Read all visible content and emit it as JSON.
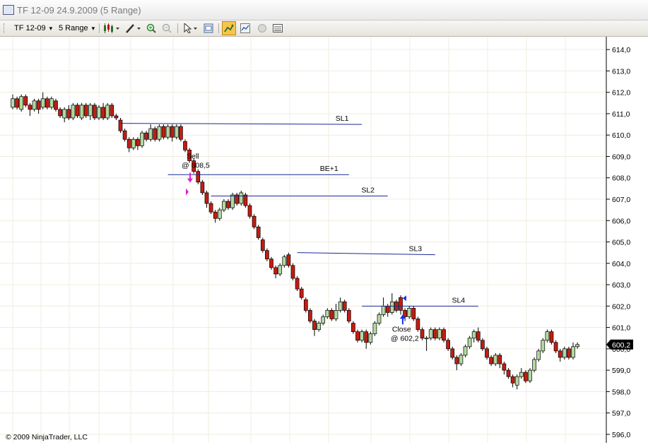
{
  "window": {
    "title": "TF 12-09   24.9.2009 (5 Range)"
  },
  "toolbar": {
    "instrument": "TF 12-09",
    "period": "5 Range",
    "icons": [
      "candlestick-icon",
      "pencil-icon",
      "zoom-in-icon",
      "zoom-out-icon",
      "cursor-icon",
      "properties-icon",
      "strategy-icon",
      "indicator-icon",
      "circle-icon",
      "data-box-icon"
    ]
  },
  "colors": {
    "up_candle": "#b4d9a2",
    "down_candle": "#c41c12",
    "draw_line": "#1c2896",
    "grid": "#f0ece0",
    "axis_bg": "#ffffff",
    "sell_marker": "#e020d0",
    "buy_marker": "#1030ff"
  },
  "chart_data": {
    "type": "candlestick",
    "ylim": [
      595.6,
      614.6
    ],
    "y_ticks": [
      "614,0",
      "613,0",
      "612,0",
      "611,0",
      "610,0",
      "609,0",
      "608,0",
      "607,0",
      "606,0",
      "605,0",
      "604,0",
      "603,0",
      "602,0",
      "601,0",
      "600,0",
      "599,0",
      "598,0",
      "597,0",
      "596,0"
    ],
    "candles": [
      {
        "o": 611.3,
        "c": 611.7,
        "h": 611.9,
        "l": 611.2
      },
      {
        "o": 611.7,
        "c": 611.3,
        "h": 611.8,
        "l": 611.2
      },
      {
        "o": 611.2,
        "c": 611.8,
        "h": 611.9,
        "l": 611.1
      },
      {
        "o": 611.8,
        "c": 611.4,
        "h": 611.9,
        "l": 611.3
      },
      {
        "o": 611.4,
        "c": 611.2,
        "h": 611.5,
        "l": 610.9
      },
      {
        "o": 611.2,
        "c": 611.6,
        "h": 611.7,
        "l": 611.1
      },
      {
        "o": 611.6,
        "c": 611.2,
        "h": 611.7,
        "l": 611.0
      },
      {
        "o": 611.3,
        "c": 611.7,
        "h": 612.0,
        "l": 611.2
      },
      {
        "o": 611.7,
        "c": 611.3,
        "h": 611.8,
        "l": 611.2
      },
      {
        "o": 611.3,
        "c": 611.7,
        "h": 611.8,
        "l": 611.2
      },
      {
        "o": 611.6,
        "c": 611.2,
        "h": 611.7,
        "l": 611.1
      },
      {
        "o": 611.2,
        "c": 610.9,
        "h": 611.3,
        "l": 610.8
      },
      {
        "o": 610.8,
        "c": 611.2,
        "h": 611.3,
        "l": 610.6
      },
      {
        "o": 611.2,
        "c": 610.8,
        "h": 611.4,
        "l": 610.7
      },
      {
        "o": 610.8,
        "c": 611.4,
        "h": 611.5,
        "l": 610.7
      },
      {
        "o": 611.4,
        "c": 610.9,
        "h": 611.5,
        "l": 610.8
      },
      {
        "o": 610.8,
        "c": 611.4,
        "h": 611.5,
        "l": 610.7
      },
      {
        "o": 611.4,
        "c": 610.9,
        "h": 611.5,
        "l": 610.8
      },
      {
        "o": 610.9,
        "c": 611.4,
        "h": 611.5,
        "l": 610.7
      },
      {
        "o": 611.4,
        "c": 610.8,
        "h": 611.5,
        "l": 610.7
      },
      {
        "o": 610.8,
        "c": 611.3,
        "h": 611.4,
        "l": 610.7
      },
      {
        "o": 611.3,
        "c": 610.8,
        "h": 611.5,
        "l": 610.7
      },
      {
        "o": 610.8,
        "c": 611.4,
        "h": 611.5,
        "l": 610.7
      },
      {
        "o": 611.4,
        "c": 610.9,
        "h": 611.5,
        "l": 610.8
      },
      {
        "o": 610.9,
        "c": 610.8,
        "h": 611.0,
        "l": 610.7
      },
      {
        "o": 610.7,
        "c": 610.2,
        "h": 610.8,
        "l": 610.1
      },
      {
        "o": 610.2,
        "c": 609.8,
        "h": 610.3,
        "l": 609.7
      },
      {
        "o": 609.8,
        "c": 609.4,
        "h": 609.9,
        "l": 609.2
      },
      {
        "o": 609.4,
        "c": 609.8,
        "h": 609.9,
        "l": 609.3
      },
      {
        "o": 609.8,
        "c": 609.5,
        "h": 609.9,
        "l": 609.3
      },
      {
        "o": 609.5,
        "c": 610.1,
        "h": 610.2,
        "l": 609.4
      },
      {
        "o": 610.1,
        "c": 609.8,
        "h": 610.2,
        "l": 609.7
      },
      {
        "o": 609.8,
        "c": 610.3,
        "h": 610.5,
        "l": 609.7
      },
      {
        "o": 610.3,
        "c": 609.8,
        "h": 610.4,
        "l": 609.7
      },
      {
        "o": 609.8,
        "c": 610.4,
        "h": 610.5,
        "l": 609.7
      },
      {
        "o": 610.4,
        "c": 609.9,
        "h": 610.5,
        "l": 609.8
      },
      {
        "o": 609.9,
        "c": 610.4,
        "h": 610.5,
        "l": 609.8
      },
      {
        "o": 610.4,
        "c": 609.9,
        "h": 610.5,
        "l": 609.7
      },
      {
        "o": 609.9,
        "c": 610.4,
        "h": 610.5,
        "l": 609.8
      },
      {
        "o": 610.4,
        "c": 609.8,
        "h": 610.5,
        "l": 609.7
      },
      {
        "o": 609.7,
        "c": 609.3,
        "h": 609.8,
        "l": 609.2
      },
      {
        "o": 609.3,
        "c": 608.8,
        "h": 609.4,
        "l": 608.7
      },
      {
        "o": 608.8,
        "c": 608.3,
        "h": 608.9,
        "l": 608.2
      },
      {
        "o": 608.3,
        "c": 607.8,
        "h": 608.4,
        "l": 607.7
      },
      {
        "o": 607.8,
        "c": 607.3,
        "h": 607.9,
        "l": 607.2
      },
      {
        "o": 607.3,
        "c": 606.8,
        "h": 607.4,
        "l": 606.6
      },
      {
        "o": 606.8,
        "c": 606.4,
        "h": 606.9,
        "l": 606.3
      },
      {
        "o": 606.4,
        "c": 606.1,
        "h": 606.5,
        "l": 605.9
      },
      {
        "o": 606.1,
        "c": 606.5,
        "h": 606.6,
        "l": 606.0
      },
      {
        "o": 606.5,
        "c": 606.9,
        "h": 607.0,
        "l": 606.4
      },
      {
        "o": 606.9,
        "c": 606.6,
        "h": 607.0,
        "l": 606.5
      },
      {
        "o": 606.6,
        "c": 607.2,
        "h": 607.3,
        "l": 606.5
      },
      {
        "o": 607.2,
        "c": 606.8,
        "h": 607.3,
        "l": 606.7
      },
      {
        "o": 606.8,
        "c": 607.3,
        "h": 607.4,
        "l": 606.7
      },
      {
        "o": 607.2,
        "c": 606.7,
        "h": 607.3,
        "l": 606.6
      },
      {
        "o": 606.7,
        "c": 606.2,
        "h": 606.8,
        "l": 606.1
      },
      {
        "o": 606.2,
        "c": 605.7,
        "h": 606.3,
        "l": 605.6
      },
      {
        "o": 605.7,
        "c": 605.2,
        "h": 605.8,
        "l": 605.1
      },
      {
        "o": 605.1,
        "c": 604.6,
        "h": 605.2,
        "l": 604.5
      },
      {
        "o": 604.6,
        "c": 604.2,
        "h": 604.7,
        "l": 604.1
      },
      {
        "o": 604.2,
        "c": 603.8,
        "h": 604.3,
        "l": 603.7
      },
      {
        "o": 603.8,
        "c": 603.5,
        "h": 603.9,
        "l": 603.3
      },
      {
        "o": 603.5,
        "c": 603.9,
        "h": 604.0,
        "l": 603.4
      },
      {
        "o": 603.9,
        "c": 604.3,
        "h": 604.4,
        "l": 603.8
      },
      {
        "o": 604.4,
        "c": 603.9,
        "h": 604.5,
        "l": 603.8
      },
      {
        "o": 603.9,
        "c": 603.3,
        "h": 604.0,
        "l": 603.2
      },
      {
        "o": 603.3,
        "c": 602.8,
        "h": 603.4,
        "l": 602.7
      },
      {
        "o": 602.8,
        "c": 602.4,
        "h": 602.9,
        "l": 602.3
      },
      {
        "o": 602.3,
        "c": 601.8,
        "h": 602.4,
        "l": 601.7
      },
      {
        "o": 601.8,
        "c": 601.3,
        "h": 601.9,
        "l": 601.2
      },
      {
        "o": 601.3,
        "c": 600.9,
        "h": 601.4,
        "l": 600.6
      },
      {
        "o": 600.9,
        "c": 601.2,
        "h": 601.3,
        "l": 600.8
      },
      {
        "o": 601.2,
        "c": 601.5,
        "h": 601.6,
        "l": 601.1
      },
      {
        "o": 601.5,
        "c": 601.8,
        "h": 601.9,
        "l": 601.4
      },
      {
        "o": 601.8,
        "c": 601.4,
        "h": 601.9,
        "l": 601.3
      },
      {
        "o": 601.4,
        "c": 601.8,
        "h": 602.1,
        "l": 601.3
      },
      {
        "o": 601.8,
        "c": 602.2,
        "h": 602.4,
        "l": 601.7
      },
      {
        "o": 602.2,
        "c": 601.8,
        "h": 602.3,
        "l": 601.7
      },
      {
        "o": 601.8,
        "c": 601.3,
        "h": 601.9,
        "l": 601.2
      },
      {
        "o": 601.2,
        "c": 600.8,
        "h": 601.3,
        "l": 600.7
      },
      {
        "o": 600.8,
        "c": 600.4,
        "h": 600.9,
        "l": 600.3
      },
      {
        "o": 600.4,
        "c": 600.8,
        "h": 600.9,
        "l": 600.3
      },
      {
        "o": 600.8,
        "c": 600.3,
        "h": 600.9,
        "l": 600.0
      },
      {
        "o": 600.3,
        "c": 600.7,
        "h": 600.8,
        "l": 600.2
      },
      {
        "o": 600.7,
        "c": 601.2,
        "h": 601.3,
        "l": 600.6
      },
      {
        "o": 601.2,
        "c": 601.6,
        "h": 601.7,
        "l": 601.1
      },
      {
        "o": 601.6,
        "c": 602.0,
        "h": 602.4,
        "l": 601.5
      },
      {
        "o": 602.0,
        "c": 601.7,
        "h": 602.1,
        "l": 601.5
      },
      {
        "o": 601.7,
        "c": 602.2,
        "h": 602.6,
        "l": 601.6
      },
      {
        "o": 602.2,
        "c": 601.8,
        "h": 602.3,
        "l": 601.7
      },
      {
        "o": 602.4,
        "c": 601.8,
        "h": 602.5,
        "l": 601.6
      },
      {
        "o": 601.8,
        "c": 601.5,
        "h": 601.9,
        "l": 601.3
      },
      {
        "o": 601.5,
        "c": 601.9,
        "h": 602.0,
        "l": 601.4
      },
      {
        "o": 601.9,
        "c": 601.4,
        "h": 602.0,
        "l": 601.3
      },
      {
        "o": 601.4,
        "c": 600.9,
        "h": 601.5,
        "l": 600.8
      },
      {
        "o": 600.9,
        "c": 600.5,
        "h": 601.0,
        "l": 600.4
      },
      {
        "o": 600.5,
        "c": 600.5,
        "h": 600.6,
        "l": 599.9
      },
      {
        "o": 600.5,
        "c": 600.9,
        "h": 601.0,
        "l": 600.4
      },
      {
        "o": 600.9,
        "c": 600.5,
        "h": 601.0,
        "l": 600.4
      },
      {
        "o": 600.5,
        "c": 600.9,
        "h": 601.0,
        "l": 600.4
      },
      {
        "o": 600.9,
        "c": 600.4,
        "h": 601.0,
        "l": 600.3
      },
      {
        "o": 600.4,
        "c": 600.0,
        "h": 600.5,
        "l": 599.9
      },
      {
        "o": 600.0,
        "c": 599.6,
        "h": 600.1,
        "l": 599.5
      },
      {
        "o": 599.6,
        "c": 599.3,
        "h": 599.7,
        "l": 599.0
      },
      {
        "o": 599.3,
        "c": 599.7,
        "h": 599.8,
        "l": 599.2
      },
      {
        "o": 599.7,
        "c": 600.1,
        "h": 600.2,
        "l": 599.6
      },
      {
        "o": 600.1,
        "c": 600.5,
        "h": 600.6,
        "l": 600.0
      },
      {
        "o": 600.5,
        "c": 600.8,
        "h": 600.9,
        "l": 600.3
      },
      {
        "o": 600.8,
        "c": 600.4,
        "h": 601.0,
        "l": 600.3
      },
      {
        "o": 600.4,
        "c": 600.0,
        "h": 600.5,
        "l": 599.9
      },
      {
        "o": 600.0,
        "c": 599.6,
        "h": 600.1,
        "l": 599.5
      },
      {
        "o": 599.6,
        "c": 599.3,
        "h": 599.7,
        "l": 599.2
      },
      {
        "o": 599.3,
        "c": 599.7,
        "h": 599.8,
        "l": 599.2
      },
      {
        "o": 599.7,
        "c": 599.3,
        "h": 599.8,
        "l": 599.1
      },
      {
        "o": 599.3,
        "c": 599.0,
        "h": 599.4,
        "l": 598.8
      },
      {
        "o": 599.0,
        "c": 598.7,
        "h": 599.1,
        "l": 598.6
      },
      {
        "o": 598.7,
        "c": 598.4,
        "h": 598.8,
        "l": 598.2
      },
      {
        "o": 598.3,
        "c": 598.7,
        "h": 598.8,
        "l": 598.1
      },
      {
        "o": 598.7,
        "c": 598.9,
        "h": 599.1,
        "l": 598.6
      },
      {
        "o": 598.9,
        "c": 598.5,
        "h": 599.0,
        "l": 598.4
      },
      {
        "o": 598.5,
        "c": 599.0,
        "h": 599.1,
        "l": 598.4
      },
      {
        "o": 599.0,
        "c": 599.5,
        "h": 599.6,
        "l": 598.9
      },
      {
        "o": 599.5,
        "c": 599.9,
        "h": 600.0,
        "l": 599.4
      },
      {
        "o": 599.9,
        "c": 600.4,
        "h": 600.5,
        "l": 599.8
      },
      {
        "o": 600.4,
        "c": 600.8,
        "h": 600.9,
        "l": 600.3
      },
      {
        "o": 600.8,
        "c": 600.3,
        "h": 600.9,
        "l": 600.2
      },
      {
        "o": 600.3,
        "c": 599.9,
        "h": 600.4,
        "l": 599.8
      },
      {
        "o": 599.9,
        "c": 599.6,
        "h": 600.0,
        "l": 599.4
      },
      {
        "o": 599.6,
        "c": 600.0,
        "h": 600.1,
        "l": 599.5
      },
      {
        "o": 600.0,
        "c": 599.6,
        "h": 600.1,
        "l": 599.5
      },
      {
        "o": 599.6,
        "c": 600.1,
        "h": 600.3,
        "l": 599.5
      },
      {
        "o": 600.1,
        "c": 600.2,
        "h": 600.3,
        "l": 600.0
      }
    ],
    "lines": [
      {
        "label": "SL1",
        "y1": 610.55,
        "y2": 610.5,
        "x1i": 25,
        "x2i": 81
      },
      {
        "label": "BE+1",
        "y1": 608.15,
        "y2": 608.15,
        "x1i": 36,
        "x2i": 78
      },
      {
        "label": "SL2",
        "y1": 607.15,
        "y2": 607.15,
        "x1i": 46,
        "x2i": 87
      },
      {
        "label": "SL3",
        "y1": 604.5,
        "y2": 604.4,
        "x1i": 66,
        "x2i": 98
      },
      {
        "label": "SL4",
        "y1": 602.0,
        "y2": 602.0,
        "x1i": 81,
        "x2i": 108
      }
    ],
    "annotations": [
      {
        "kind": "sell",
        "label": "Sell",
        "price_label": "@ 608,5",
        "price": 608.5,
        "bar": 40
      },
      {
        "kind": "close",
        "label": "Close",
        "price_label": "@ 602,2",
        "price": 602.2,
        "bar": 89
      }
    ],
    "last_price": "600,2",
    "last_value": 600.2
  },
  "footer": {
    "copyright": "© 2009 NinjaTrader, LLC"
  }
}
